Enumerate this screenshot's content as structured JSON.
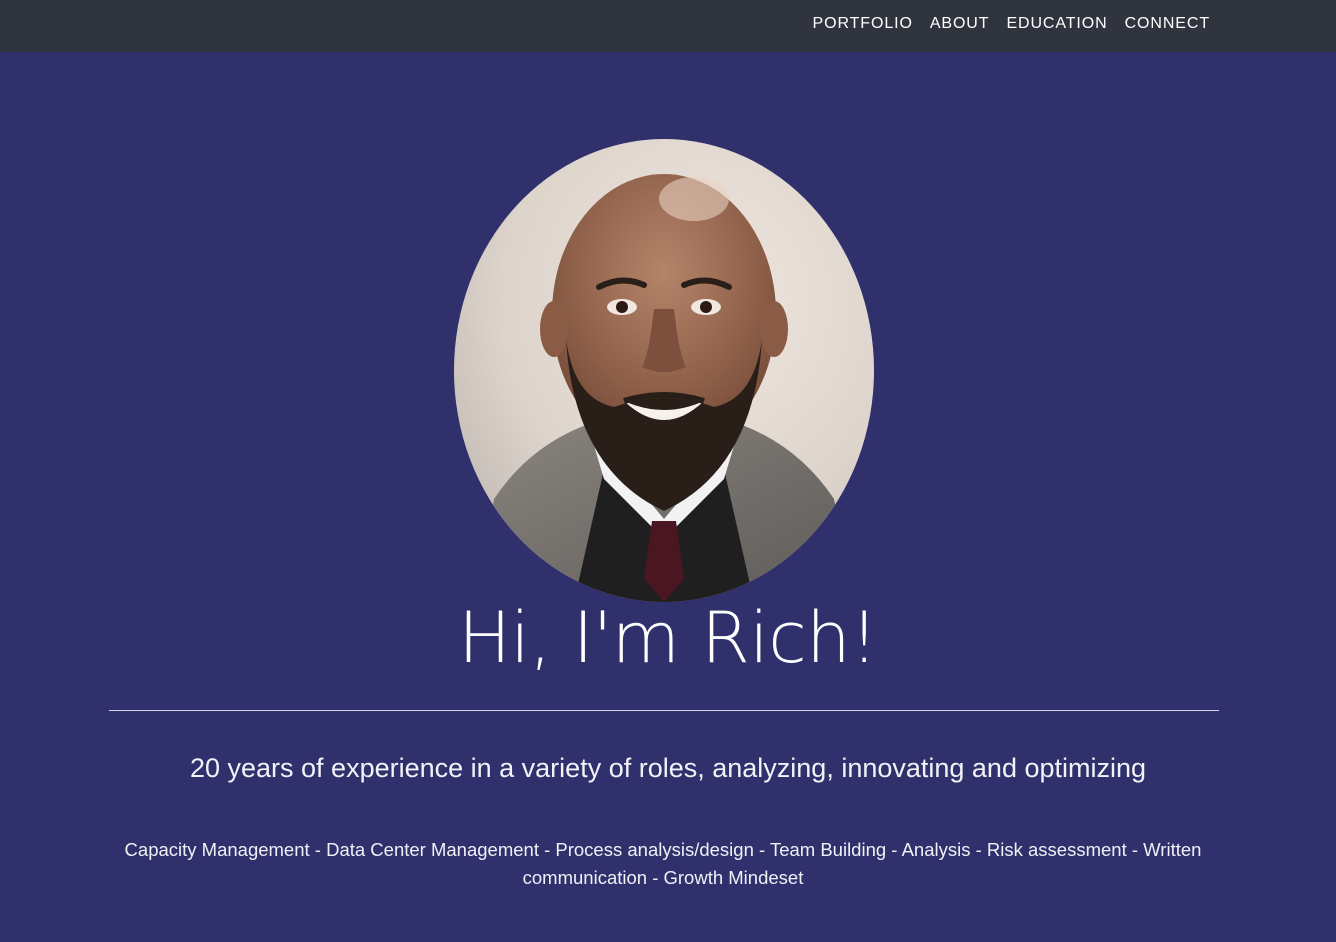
{
  "nav": {
    "items": [
      {
        "label": "PORTFOLIO"
      },
      {
        "label": "ABOUT"
      },
      {
        "label": "EDUCATION"
      },
      {
        "label": "CONNECT"
      }
    ]
  },
  "hero": {
    "headline": "Hi, I'm Rich!",
    "tagline": "20 years of experience in a variety of roles, analyzing, innovating and optimizing",
    "skills": "Capacity Management - Data Center Management - Process analysis/design - Team Building - Analysis - Risk assessment - Written communication - Growth Mindeset"
  },
  "colors": {
    "navbar_bg": "#2f343f",
    "hero_bg": "#30316c",
    "text": "#ffffff"
  }
}
